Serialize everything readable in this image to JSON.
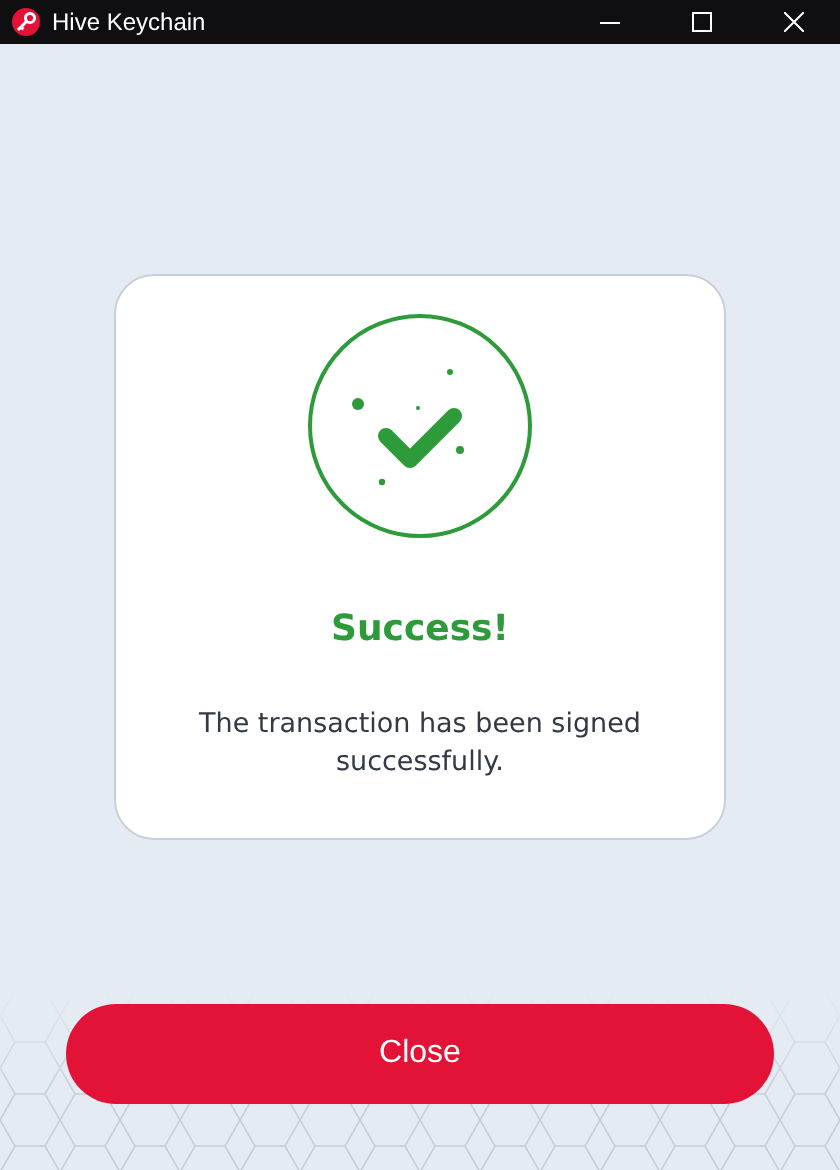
{
  "window": {
    "title": "Hive Keychain"
  },
  "dialog": {
    "title": "Success!",
    "message": "The transaction has been signed successfully."
  },
  "buttons": [
    {
      "label": "Close"
    }
  ]
}
